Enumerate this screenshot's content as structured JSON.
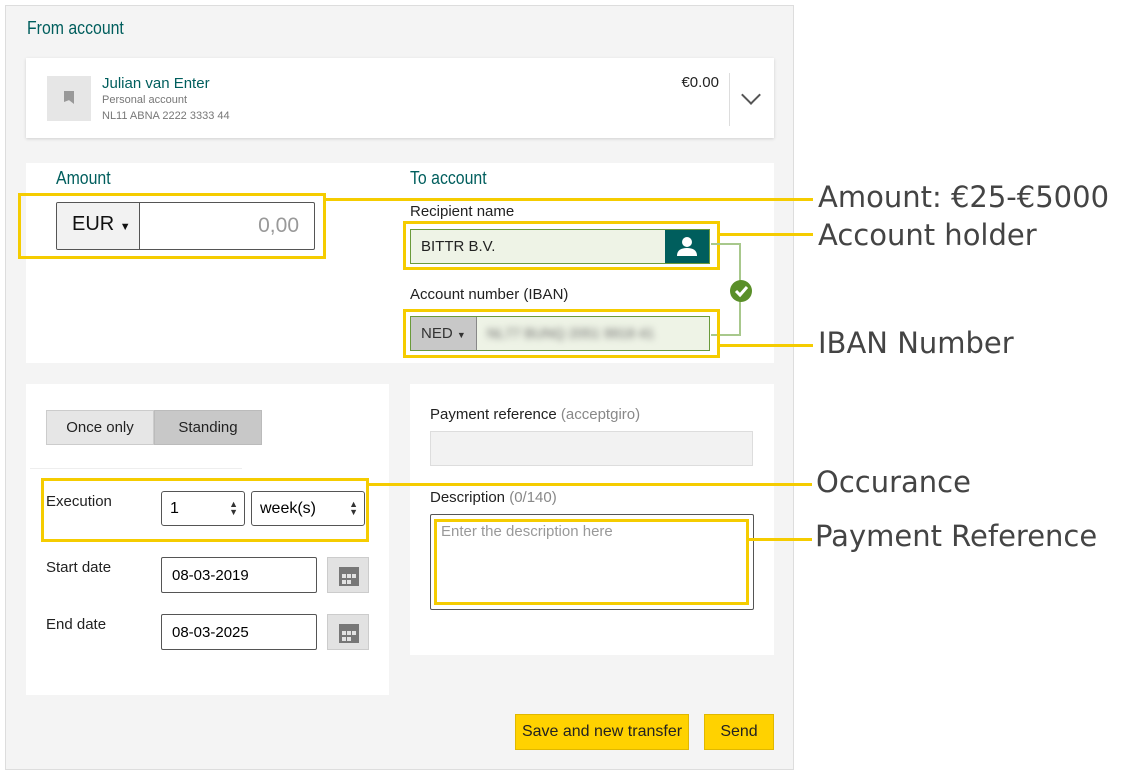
{
  "from_account": {
    "title": "From account",
    "name": "Julian van Enter",
    "type": "Personal account",
    "iban": "NL11 ABNA 2222 3333 44",
    "balance": "€0.00"
  },
  "amount": {
    "title": "Amount",
    "currency": "EUR",
    "placeholder": "0,00"
  },
  "to_account": {
    "title": "To account",
    "recipient_label": "Recipient name",
    "recipient_value": "BITTR B.V.",
    "iban_label": "Account number (IBAN)",
    "country": "NED",
    "iban_value": "NL77 BUNQ 2051 9918 41"
  },
  "schedule": {
    "tabs": [
      {
        "label": "Once only",
        "selected": false
      },
      {
        "label": "Standing",
        "selected": true
      }
    ],
    "execution_label": "Execution",
    "execution_count": "1",
    "execution_unit": "week(s)",
    "start_label": "Start date",
    "start_value": "08-03-2019",
    "end_label": "End date",
    "end_value": "08-03-2025"
  },
  "details": {
    "payment_ref_label": "Payment reference",
    "payment_ref_hint": "(acceptgiro)",
    "description_label": "Description",
    "description_count": "(0/140)",
    "description_placeholder": "Enter the description here"
  },
  "actions": {
    "save_new": "Save and new transfer",
    "send": "Send"
  },
  "annotations": {
    "amount": "Amount: €25-€5000",
    "holder": "Account holder",
    "iban": "IBAN Number",
    "occurance": "Occurance",
    "reference": "Payment Reference"
  },
  "colors": {
    "brand": "#005e5d",
    "highlight": "#f5cc00",
    "valid": "#5a8f29",
    "button": "#ffd200"
  }
}
